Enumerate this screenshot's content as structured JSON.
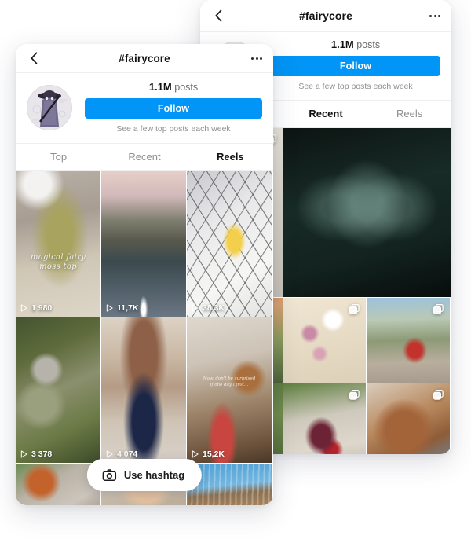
{
  "app": {
    "name": "instagram-hashtag-page"
  },
  "phone_back": {
    "nav": {
      "back_icon": "chevron-left-icon",
      "title": "#fairycore",
      "menu_icon": "ellipsis-icon"
    },
    "profile": {
      "avatar_icon": "hashtag-avatar",
      "posts_count": "1.1M",
      "posts_label": "posts",
      "follow_label": "Follow",
      "sub_note": "See a few top posts each week"
    },
    "tabs": [
      {
        "label": "Top",
        "active": false
      },
      {
        "label": "Recent",
        "active": true
      },
      {
        "label": "Reels",
        "active": false
      }
    ],
    "grid": [
      {
        "name": "post-manuscript-fairy",
        "multi": true
      },
      {
        "name": "post-dark-fairy-forest",
        "multi": false
      },
      {
        "name": "post-autumn-leaves",
        "multi": false
      },
      {
        "name": "post-floral-gown",
        "multi": true
      },
      {
        "name": "post-fountain-red-cardigan",
        "multi": true
      },
      {
        "name": "post-green-garden",
        "multi": false
      },
      {
        "name": "post-flower-crown-wine-dress",
        "multi": true
      },
      {
        "name": "post-portrait-sunlight",
        "multi": true
      }
    ]
  },
  "phone_front": {
    "nav": {
      "back_icon": "chevron-left-icon",
      "title": "#fairycore",
      "menu_icon": "ellipsis-icon"
    },
    "profile": {
      "avatar_icon": "hashtag-avatar",
      "posts_count": "1.1M",
      "posts_label": "posts",
      "follow_label": "Follow",
      "sub_note": "See a few top posts each week"
    },
    "tabs": [
      {
        "label": "Top",
        "active": false
      },
      {
        "label": "Recent",
        "active": false
      },
      {
        "label": "Reels",
        "active": true
      }
    ],
    "reels": [
      {
        "name": "reel-moss-top",
        "views": "1 980",
        "caption": "magical fairy\nmoss top"
      },
      {
        "name": "reel-village-river-duck",
        "views": "11,7K",
        "caption": ""
      },
      {
        "name": "reel-duckling-bed",
        "views": "38,3K",
        "caption": ""
      },
      {
        "name": "reel-fairy-garden-stone",
        "views": "3 378",
        "caption": ""
      },
      {
        "name": "reel-blue-dress-arcade",
        "views": "4 074",
        "caption": ""
      },
      {
        "name": "reel-strawberry-waffle",
        "views": "15,2K",
        "caption": "Now, don't be surprised\nif one day I just..."
      }
    ],
    "bottom_row": [
      {
        "name": "reel-partial-orange-dress"
      },
      {
        "name": "reel-partial-portrait"
      },
      {
        "name": "reel-partial-blue-sky"
      }
    ],
    "use_hashtag": {
      "icon": "camera-icon",
      "label": "Use hashtag"
    }
  },
  "colors": {
    "accent_blue": "#0095f6",
    "text_primary": "#121212",
    "text_secondary": "#8e8e8e",
    "card_white": "#ffffff",
    "page_background": "#ffffff"
  }
}
